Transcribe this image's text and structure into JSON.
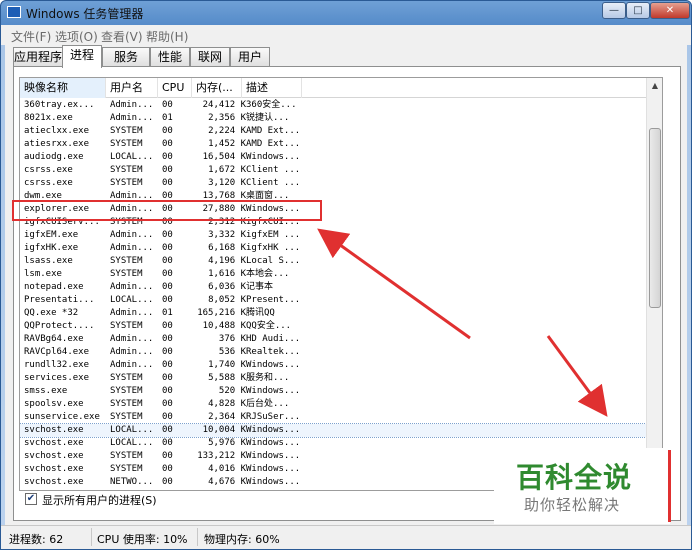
{
  "window": {
    "title": "Windows 任务管理器"
  },
  "window_controls": {
    "minimize": "—",
    "maximize": "□",
    "close": "✕"
  },
  "menu": [
    "文件(F)",
    "选项(O)",
    "查看(V)",
    "帮助(H)"
  ],
  "tabs": [
    "应用程序",
    "进程",
    "服务",
    "性能",
    "联网",
    "用户"
  ],
  "active_tab": "进程",
  "columns": [
    "映像名称",
    "用户名",
    "CPU",
    "内存(...",
    "描述"
  ],
  "processes": [
    [
      "360tray.ex...",
      "Admin...",
      "00",
      "24,412 K",
      "360安全..."
    ],
    [
      "8021x.exe",
      "Admin...",
      "01",
      "2,356 K",
      "锐捷认..."
    ],
    [
      "atieclxx.exe",
      "SYSTEM",
      "00",
      "2,224 K",
      "AMD Ext..."
    ],
    [
      "atiesrxx.exe",
      "SYSTEM",
      "00",
      "1,452 K",
      "AMD Ext..."
    ],
    [
      "audiodg.exe",
      "LOCAL...",
      "00",
      "16,504 K",
      "Windows..."
    ],
    [
      "csrss.exe",
      "SYSTEM",
      "00",
      "1,672 K",
      "Client ..."
    ],
    [
      "csrss.exe",
      "SYSTEM",
      "00",
      "3,120 K",
      "Client ..."
    ],
    [
      "dwm.exe",
      "Admin...",
      "00",
      "13,768 K",
      "桌面窗..."
    ],
    [
      "explorer.exe",
      "Admin...",
      "00",
      "27,880 K",
      "Windows..."
    ],
    [
      "igfxCUIServ...",
      "SYSTEM",
      "00",
      "2,312 K",
      "igfxCUI..."
    ],
    [
      "igfxEM.exe",
      "Admin...",
      "00",
      "3,332 K",
      "igfxEM ..."
    ],
    [
      "igfxHK.exe",
      "Admin...",
      "00",
      "6,168 K",
      "igfxHK ..."
    ],
    [
      "lsass.exe",
      "SYSTEM",
      "00",
      "4,196 K",
      "Local S..."
    ],
    [
      "lsm.exe",
      "SYSTEM",
      "00",
      "1,616 K",
      "本地会..."
    ],
    [
      "notepad.exe",
      "Admin...",
      "00",
      "6,036 K",
      "记事本"
    ],
    [
      "Presentati...",
      "LOCAL...",
      "00",
      "8,052 K",
      "Present..."
    ],
    [
      "QQ.exe *32",
      "Admin...",
      "01",
      "165,216 K",
      "腾讯QQ"
    ],
    [
      "QQProtect....",
      "SYSTEM",
      "00",
      "10,488 K",
      "QQ安全..."
    ],
    [
      "RAVBg64.exe",
      "Admin...",
      "00",
      "376 K",
      "HD Audi..."
    ],
    [
      "RAVCpl64.exe",
      "Admin...",
      "00",
      "536 K",
      "Realtek..."
    ],
    [
      "rundll32.exe",
      "Admin...",
      "00",
      "1,740 K",
      "Windows..."
    ],
    [
      "services.exe",
      "SYSTEM",
      "00",
      "5,588 K",
      "服务和..."
    ],
    [
      "smss.exe",
      "SYSTEM",
      "00",
      "520 K",
      "Windows..."
    ],
    [
      "spoolsv.exe",
      "SYSTEM",
      "00",
      "4,828 K",
      "后台处..."
    ],
    [
      "sunservice.exe",
      "SYSTEM",
      "00",
      "2,364 K",
      "RJSuSer..."
    ],
    [
      "svchost.exe",
      "LOCAL...",
      "00",
      "10,004 K",
      "Windows..."
    ],
    [
      "svchost.exe",
      "LOCAL...",
      "00",
      "5,976 K",
      "Windows..."
    ],
    [
      "svchost.exe",
      "SYSTEM",
      "00",
      "133,212 K",
      "Windows..."
    ],
    [
      "svchost.exe",
      "SYSTEM",
      "00",
      "4,016 K",
      "Windows..."
    ],
    [
      "svchost.exe",
      "NETWO...",
      "00",
      "4,676 K",
      "Windows..."
    ]
  ],
  "show_all_users": {
    "label": "显示所有用户的进程(S)",
    "checked": "✔"
  },
  "status": {
    "processes": "进程数: 62",
    "cpu": "CPU 使用率: 10%",
    "memory": "物理内存: 60%"
  },
  "watermark": {
    "title": "百科全说",
    "subtitle": "助你轻松解决"
  },
  "colors": {
    "annotation": "#e03030",
    "watermark_green": "#2f8a2f"
  }
}
